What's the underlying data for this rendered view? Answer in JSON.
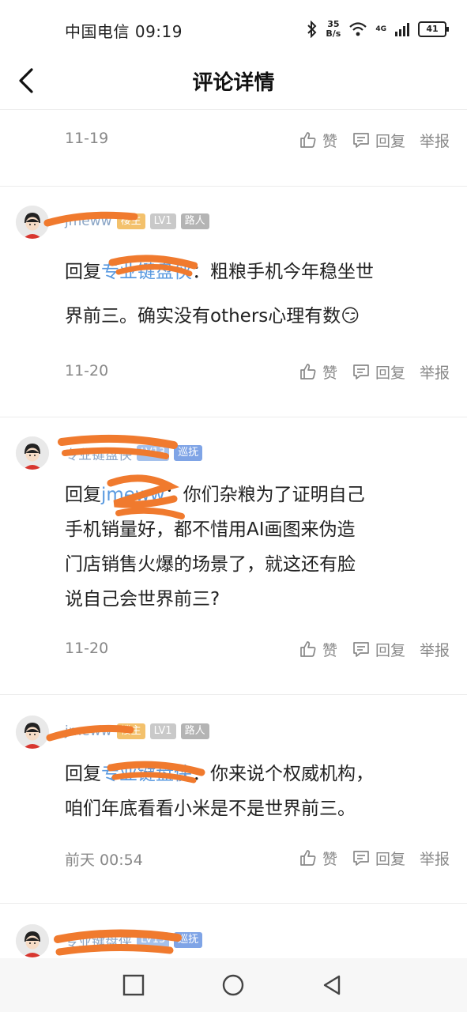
{
  "status": {
    "carrier_time": "中国电信 09:19",
    "speed_value": "35",
    "speed_unit": "B/s",
    "network": "4G",
    "battery": "41"
  },
  "header": {
    "title": "评论详情"
  },
  "actions": {
    "like": "赞",
    "reply": "回复",
    "report": "举报"
  },
  "reply_prefix": "回复",
  "colon": "：",
  "comments": [
    {
      "date": "11-19"
    },
    {
      "username": "jmeww",
      "badges": [
        "楼主",
        "LV1",
        "路人"
      ],
      "reply_to": "专业键盘侠",
      "text_a": "粗粮手机今年稳坐世",
      "text_b": "界前三。确实没有others心理有数",
      "emoji": "😏",
      "date": "11-20"
    },
    {
      "username": "专业键盘侠",
      "badges": [
        "LV13",
        "巡抚"
      ],
      "reply_to": "jmeww",
      "text_a": "你们杂粮为了证明自己",
      "text_b": "手机销量好，都不惜用AI画图来伪造",
      "text_c": "门店销售火爆的场景了，就这还有脸",
      "text_d": "说自己会世界前三?",
      "date": "11-20"
    },
    {
      "username": "jmeww",
      "badges": [
        "楼主",
        "LV1",
        "路人"
      ],
      "reply_to": "专业键盘侠",
      "text_a": "你来说个权威机构，",
      "text_b": "咱们年底看看小米是不是世界前三。",
      "date": "前天 00:54"
    },
    {
      "username": "专业键盘侠",
      "badges": [
        "LV13",
        "巡抚"
      ]
    }
  ],
  "colors": {
    "accent": "#5a9ae0",
    "scribble": "#f07a2e"
  }
}
